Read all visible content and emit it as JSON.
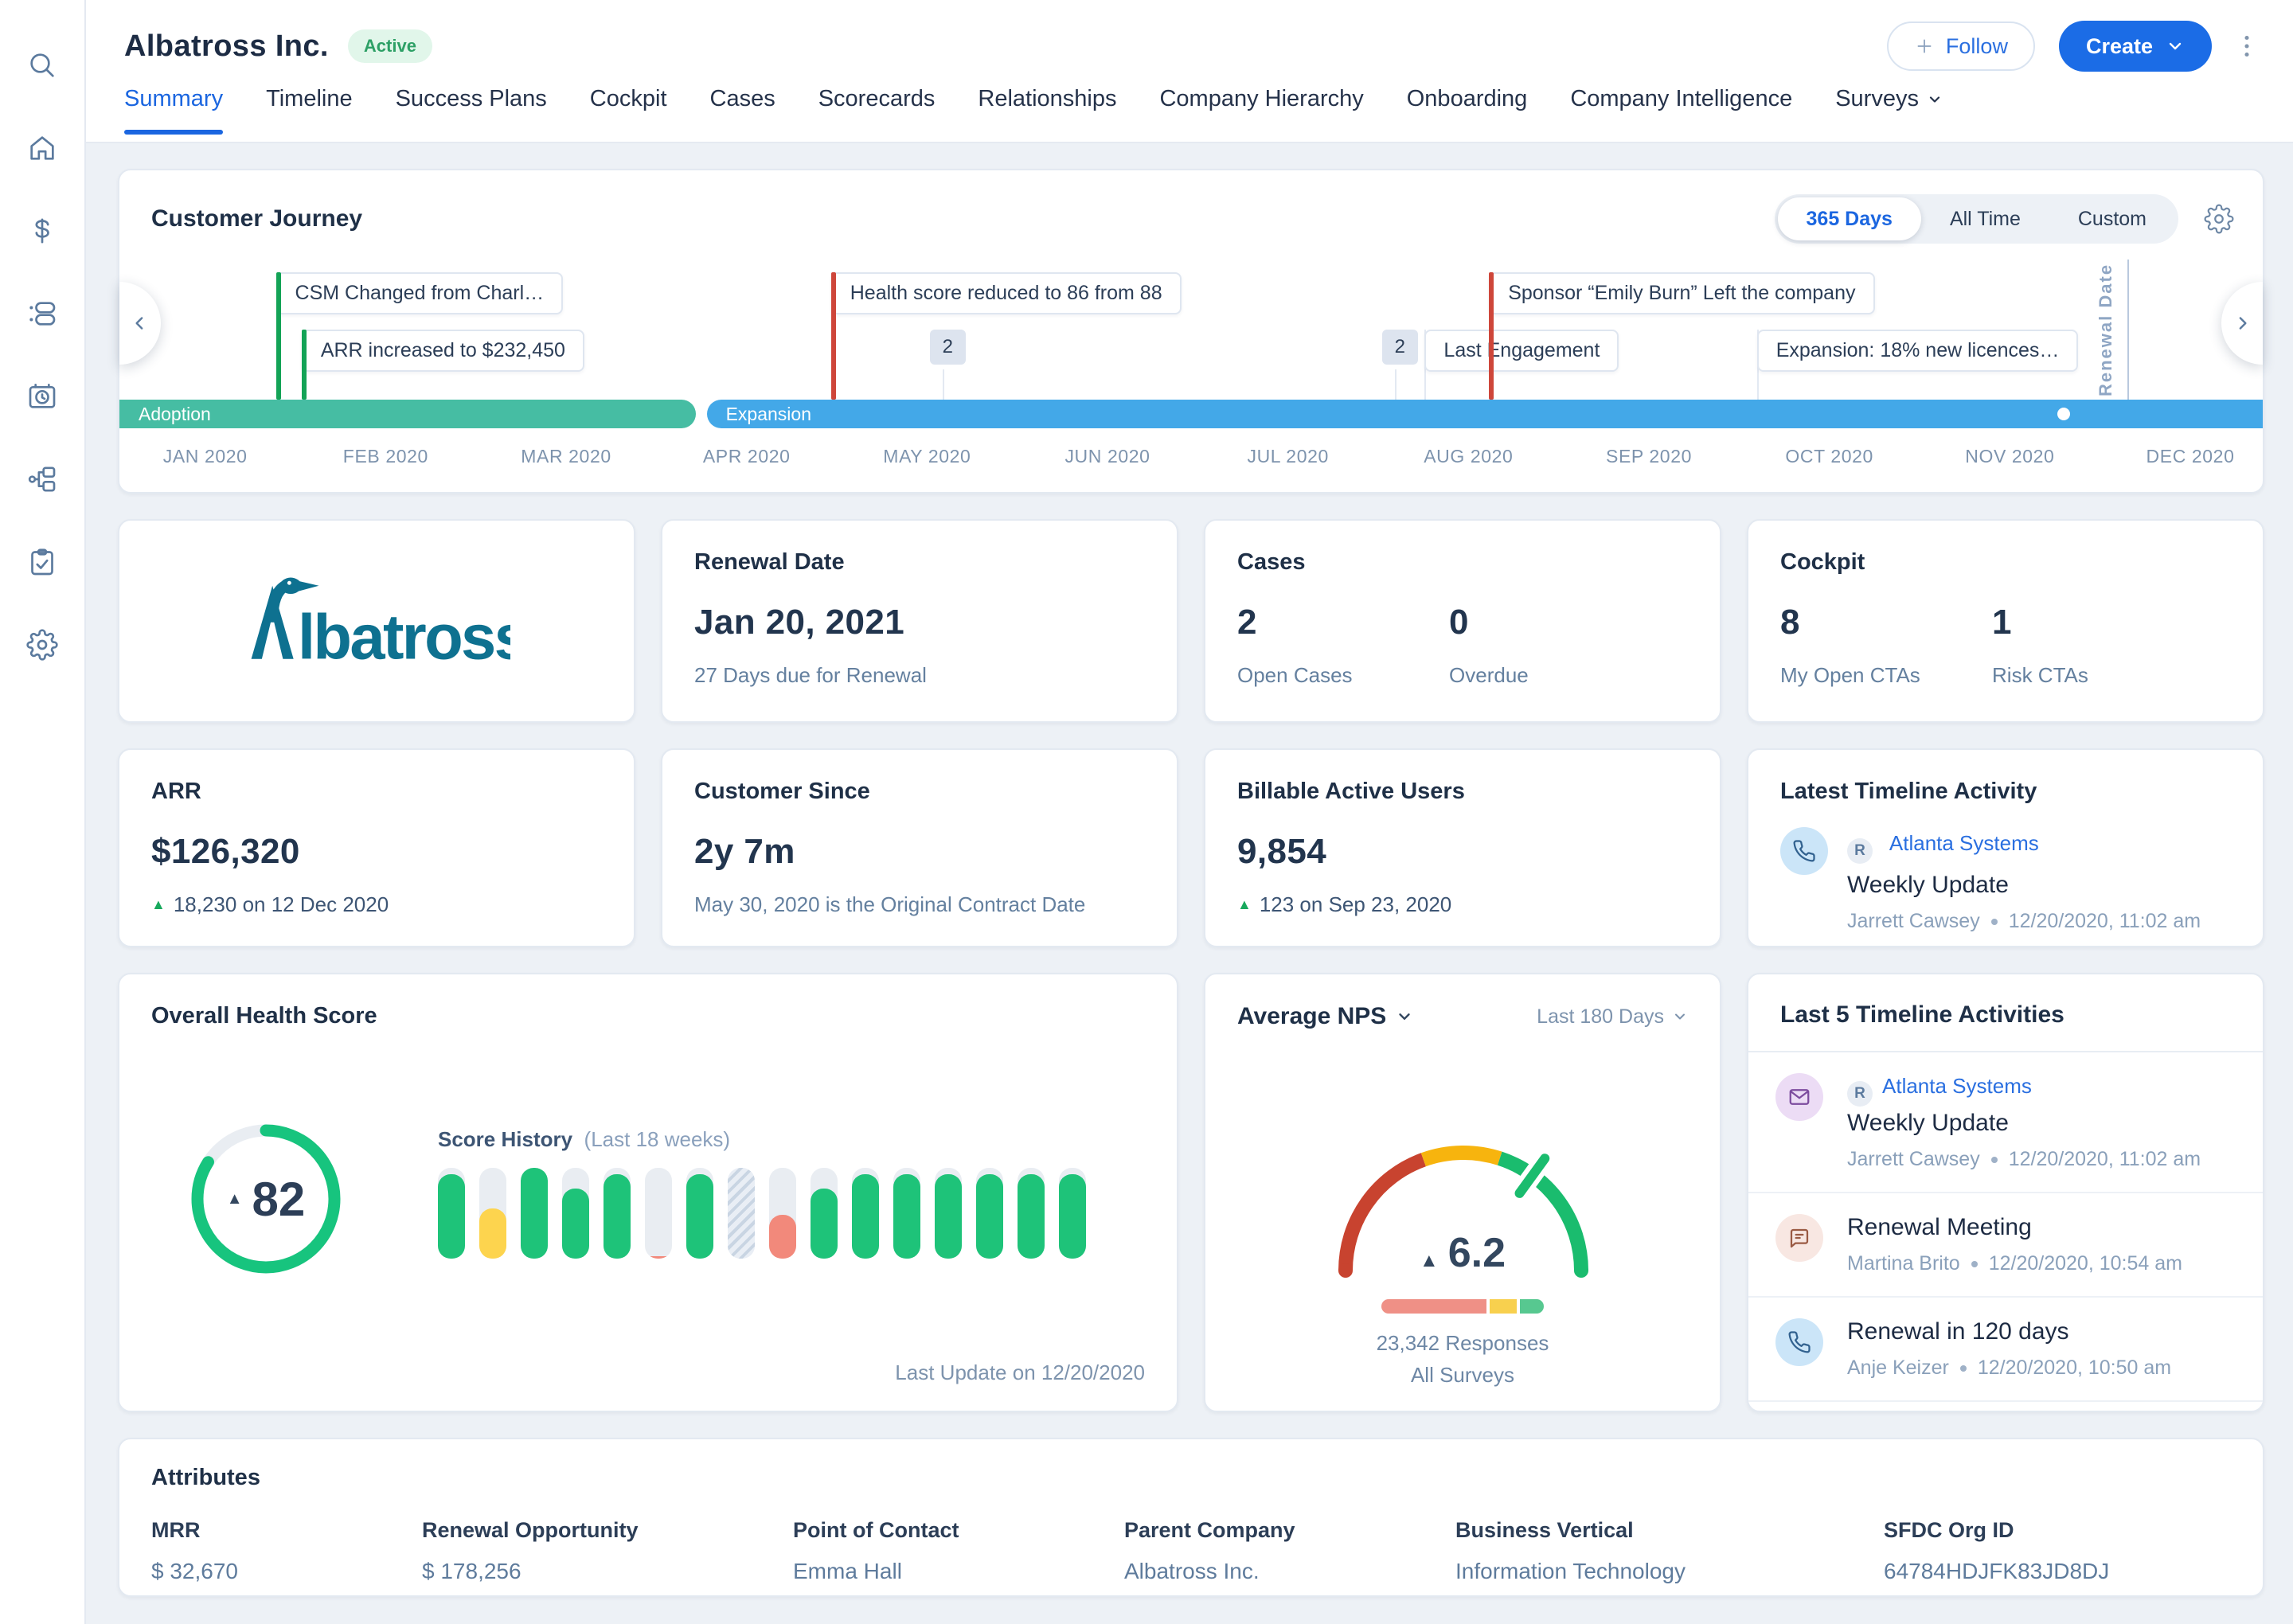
{
  "header": {
    "title": "Albatross Inc.",
    "status_badge": "Active",
    "follow_label": "Follow",
    "create_label": "Create",
    "tabs": [
      {
        "label": "Summary",
        "active": true
      },
      {
        "label": "Timeline"
      },
      {
        "label": "Success Plans"
      },
      {
        "label": "Cockpit"
      },
      {
        "label": "Cases"
      },
      {
        "label": "Scorecards"
      },
      {
        "label": "Relationships"
      },
      {
        "label": "Company Hierarchy"
      },
      {
        "label": "Onboarding"
      },
      {
        "label": "Company Intelligence"
      },
      {
        "label": "Surveys",
        "dropdown": true
      }
    ]
  },
  "sidebar": {
    "icons": [
      "search",
      "home",
      "revenue",
      "cta-list",
      "timeline",
      "hierarchy",
      "surveys",
      "settings"
    ]
  },
  "logo": {
    "company": "Albatross",
    "wordmark": "lbatross",
    "color": "#0e7190"
  },
  "journey": {
    "title": "Customer Journey",
    "range_options": [
      "365 Days",
      "All Time",
      "Custom"
    ],
    "selected_range": "365 Days",
    "phases": [
      {
        "label": "Adoption",
        "start_pct": 0,
        "end_pct": 26.9,
        "color": "#46bda3"
      },
      {
        "label": "Expansion",
        "start_pct": 27.4,
        "end_pct": 100,
        "color": "#43a8e8"
      }
    ],
    "months": [
      "JAN 2020",
      "FEB 2020",
      "MAR 2020",
      "APR 2020",
      "MAY 2020",
      "JUN 2020",
      "JUL 2020",
      "AUG 2020",
      "SEP 2020",
      "OCT 2020",
      "NOV 2020",
      "DEC 2020"
    ],
    "events": [
      {
        "label": "CSM Changed from Charl…",
        "type": "green",
        "row": 1,
        "left_pct": 7.3
      },
      {
        "label": "ARR increased to $232,450",
        "type": "green",
        "row": 2,
        "left_pct": 8.5
      },
      {
        "label": "Health score reduced to 86 from 88",
        "type": "red",
        "row": 1,
        "left_pct": 33.2
      },
      {
        "label": "2",
        "type": "badge",
        "row": 2,
        "left_pct": 37.8
      },
      {
        "label": "2",
        "type": "badge",
        "row": 2,
        "left_pct": 58.9
      },
      {
        "label": "Last Engagement",
        "type": "plain",
        "row": 2,
        "left_pct": 60.9
      },
      {
        "label": "Sponsor “Emily Burn” Left the company",
        "type": "red",
        "row": 1,
        "left_pct": 63.9
      },
      {
        "label": "Expansion: 18% new licences…",
        "type": "plain",
        "row": 2,
        "left_pct": 76.4
      }
    ],
    "renewal_marker": {
      "label": "Renewal Date",
      "left_pct": 93.7
    },
    "progress_dot_pct": 90.4
  },
  "cards": {
    "renewal": {
      "title": "Renewal Date",
      "value": "Jan 20, 2021",
      "subtext": "27 Days due for Renewal"
    },
    "cases": {
      "title": "Cases",
      "metrics": [
        {
          "value": "2",
          "label": "Open Cases"
        },
        {
          "value": "0",
          "label": "Overdue"
        }
      ]
    },
    "cockpit": {
      "title": "Cockpit",
      "metrics": [
        {
          "value": "8",
          "label": "My Open CTAs"
        },
        {
          "value": "1",
          "label": "Risk CTAs"
        }
      ]
    },
    "arr": {
      "title": "ARR",
      "value": "$126,320",
      "delta": "18,230 on 12 Dec 2020"
    },
    "customer_since": {
      "title": "Customer Since",
      "value": "2y 7m",
      "subtext": "May 30, 2020 is the Original Contract Date"
    },
    "billable": {
      "title": "Billable Active Users",
      "value": "9,854",
      "delta": "123 on Sep 23, 2020"
    },
    "latest_activity": {
      "title": "Latest Timeline Activity",
      "icon": "call",
      "relationship_badge": "R",
      "relationship": "Atlanta Systems",
      "activity": "Weekly Update",
      "author": "Jarrett Cawsey",
      "timestamp": "12/20/2020, 11:02 am"
    }
  },
  "health": {
    "title": "Overall Health Score",
    "score": "82",
    "ring_fraction": 0.84,
    "ring_color": "#17c47e",
    "history_title": "Score History",
    "history_subtitle": "(Last 18 weeks)",
    "last_update": "Last Update on 12/20/2020",
    "bars": [
      {
        "value": 93,
        "color": "green"
      },
      {
        "value": 55,
        "color": "yellow"
      },
      {
        "value": 100,
        "color": "green"
      },
      {
        "value": 77,
        "color": "green"
      },
      {
        "value": 93,
        "color": "green"
      },
      {
        "value": 3,
        "color": "red"
      },
      {
        "value": 93,
        "color": "green"
      },
      {
        "value": 100,
        "color": "hatch"
      },
      {
        "value": 48,
        "color": "red"
      },
      {
        "value": 77,
        "color": "green"
      },
      {
        "value": 93,
        "color": "green"
      },
      {
        "value": 93,
        "color": "green"
      },
      {
        "value": 93,
        "color": "green"
      },
      {
        "value": 93,
        "color": "green"
      },
      {
        "value": 93,
        "color": "green"
      },
      {
        "value": 93,
        "color": "green"
      }
    ]
  },
  "nps": {
    "title": "Average NPS",
    "range": "Last 180 Days",
    "value": "6.2",
    "responses": "23,342 Responses",
    "scope": "All Surveys",
    "gauge_segments": [
      {
        "to": 0.39,
        "color": "#c8432f"
      },
      {
        "to": 0.6,
        "color": "#f7b40e"
      },
      {
        "to": 1.0,
        "color": "#1abc6e"
      }
    ],
    "tick_fraction": 0.7,
    "distribution": [
      {
        "pct": 66,
        "color": "#ef9086"
      },
      {
        "pct": 17,
        "color": "#f8d04e"
      },
      {
        "pct": 15,
        "color": "#57c890"
      }
    ]
  },
  "activities": {
    "title": "Last 5 Timeline Activities",
    "items": [
      {
        "icon": "email",
        "relationship_badge": "R",
        "relationship": "Atlanta Systems",
        "title": "Weekly Update",
        "author": "Jarrett Cawsey",
        "timestamp": "12/20/2020, 11:02 am"
      },
      {
        "icon": "meeting",
        "title": "Renewal Meeting",
        "author": "Martina Brito",
        "timestamp": "12/20/2020, 10:54 am"
      },
      {
        "icon": "call",
        "title": "Renewal in 120 days",
        "author": "Anje Keizer",
        "timestamp": "12/20/2020, 10:50 am"
      }
    ]
  },
  "attributes": {
    "title": "Attributes",
    "fields": [
      {
        "label": "MRR",
        "value": "$ 32,670"
      },
      {
        "label": "Renewal Opportunity",
        "value": "$ 178,256"
      },
      {
        "label": "Point of Contact",
        "value": "Emma Hall"
      },
      {
        "label": "Parent Company",
        "value": "Albatross Inc."
      },
      {
        "label": "Business Vertical",
        "value": "Information Technology"
      },
      {
        "label": "SFDC Org ID",
        "value": "64784HDJFK83JD8DJ"
      }
    ]
  }
}
